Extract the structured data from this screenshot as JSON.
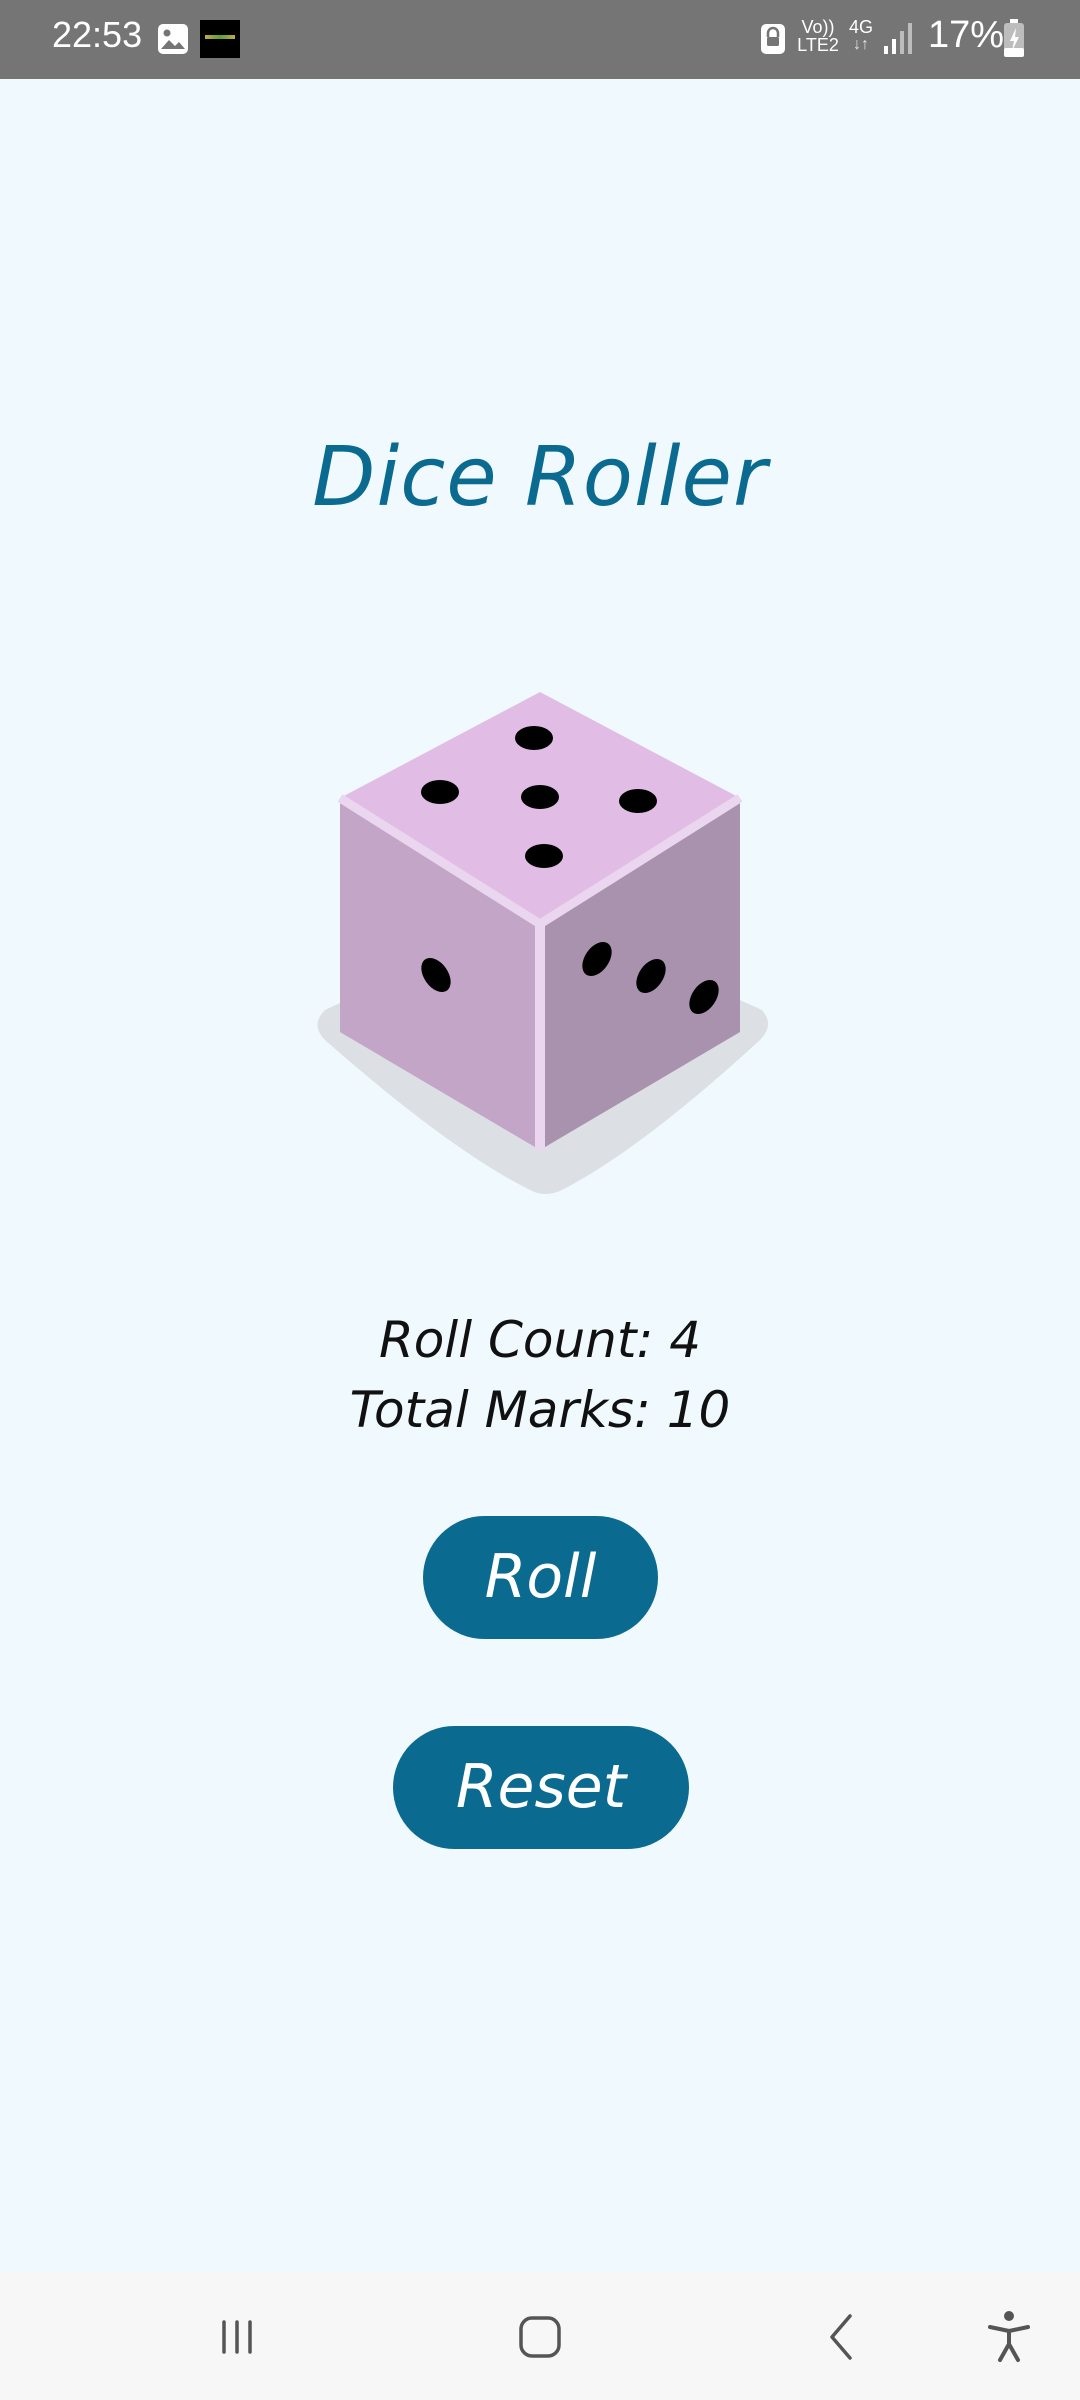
{
  "status_bar": {
    "time": "22:53",
    "volte_line1": "Vo))",
    "volte_line2": "LTE2",
    "network": "4G",
    "battery": "17%",
    "icons": [
      "gallery-icon",
      "app-thumbnail-icon",
      "lock-icon",
      "signal-icon",
      "battery-icon"
    ]
  },
  "app": {
    "title": "Dice Roller",
    "dice": {
      "top_face": 5,
      "left_face": 1,
      "right_face": 3,
      "top_color": "#e1bde6",
      "left_color": "#c2a5c7",
      "right_color": "#a992ad",
      "edge_color": "#ead6ee",
      "shadow_color": "#dcdfe3"
    },
    "roll_count_text": "Roll Count: 4",
    "total_marks_text": "Total Marks: 10",
    "roll_button": "Roll",
    "reset_button": "Reset",
    "accent_color": "#0b6a8f",
    "background_color": "#f0f9fe"
  },
  "nav_bar": {
    "icons": [
      "recent-apps-icon",
      "home-icon",
      "back-icon",
      "accessibility-icon"
    ]
  }
}
